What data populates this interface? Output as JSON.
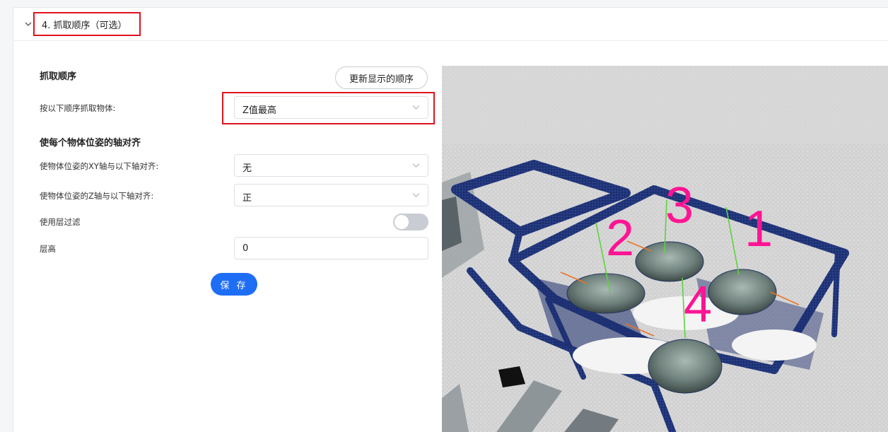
{
  "section": {
    "title": "4. 抓取顺序（可选）"
  },
  "grab_order": {
    "heading": "抓取顺序",
    "refresh_button": "更新显示的顺序",
    "order_label": "按以下顺序抓取物体:",
    "order_value": "Z值最高"
  },
  "align": {
    "heading": "使每个物体位姿的轴对齐",
    "xy_label": "使物体位姿的XY轴与以下轴对齐:",
    "xy_value": "无",
    "z_label": "使物体位姿的Z轴与以下轴对齐:",
    "z_value": "正",
    "layer_filter_label": "使用层过滤",
    "layer_filter_enabled": false,
    "layer_height_label": "层高",
    "layer_height_value": "0"
  },
  "save_button": "保 存",
  "viewer": {
    "order_labels": [
      "1",
      "2",
      "3",
      "4"
    ],
    "label_color": "#ff1493",
    "frame_color": "#1c2f78"
  }
}
